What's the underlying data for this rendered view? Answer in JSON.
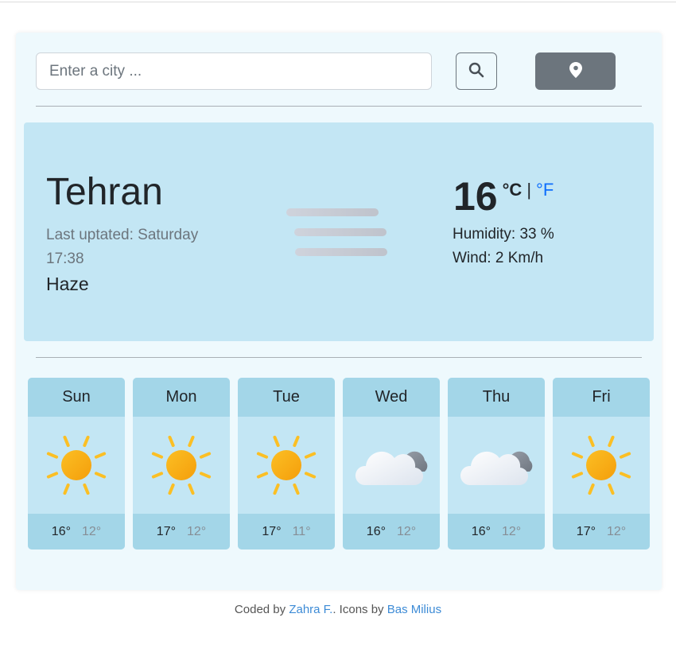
{
  "search": {
    "placeholder": "Enter a city ...",
    "value": ""
  },
  "icons": {
    "search": "search-icon",
    "location": "map-pin-icon",
    "current": "haze-icon"
  },
  "current": {
    "city": "Tehran",
    "updated_label": "Last uptated: Saturday",
    "updated_time": "17:38",
    "description": "Haze",
    "temperature": "16",
    "unit_c": "°C",
    "unit_separator": "|",
    "unit_f": "°F",
    "humidity": "Humidity: 33 %",
    "wind": "Wind: 2 Km/h"
  },
  "forecast": [
    {
      "day": "Sun",
      "max": "16°",
      "min": "12°",
      "icon": "sun-icon"
    },
    {
      "day": "Mon",
      "max": "17°",
      "min": "12°",
      "icon": "sun-icon"
    },
    {
      "day": "Tue",
      "max": "17°",
      "min": "11°",
      "icon": "sun-icon"
    },
    {
      "day": "Wed",
      "max": "16°",
      "min": "12°",
      "icon": "cloud-icon"
    },
    {
      "day": "Thu",
      "max": "16°",
      "min": "12°",
      "icon": "cloud-icon"
    },
    {
      "day": "Fri",
      "max": "17°",
      "min": "12°",
      "icon": "sun-icon"
    }
  ],
  "footer": {
    "coded_by": "Coded by",
    "author": "Zahra F.",
    "icons_by": ". Icons by",
    "icons_author": "Bas Milius"
  },
  "colors": {
    "card_bg": "#eef9fd",
    "panel_bg": "#c3e6f4",
    "panel_header": "#a3d6e8",
    "accent_link": "#0d6efd",
    "location_button": "#6c757d"
  }
}
